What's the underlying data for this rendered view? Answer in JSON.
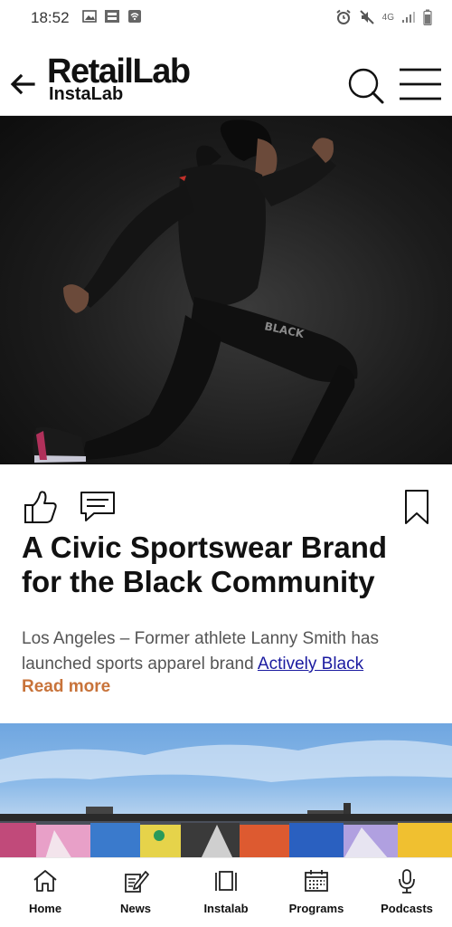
{
  "status_bar": {
    "time": "18:52",
    "network": "4G",
    "left_icons": [
      "image-icon",
      "stop-covid-icon",
      "wifi-calling-icon"
    ],
    "right_icons": [
      "alarm-icon",
      "mute-icon",
      "network-4g-icon",
      "signal-icon",
      "battery-icon"
    ]
  },
  "header": {
    "logo_main": "RetailLab",
    "logo_sub": "InstaLab",
    "icons": [
      "back-arrow-icon",
      "search-icon",
      "menu-icon"
    ]
  },
  "hero": {
    "garment_text": "BLACK"
  },
  "article": {
    "title": "A Civic Sportswear Brand for the Black Community",
    "excerpt_text": "Los Angeles – Former athlete Lanny Smith has launched sports apparel brand ",
    "excerpt_link": "Actively Black",
    "read_more": "Read more",
    "action_icons": [
      "thumbs-up-icon",
      "comment-icon",
      "bookmark-icon"
    ]
  },
  "bottom_nav": [
    {
      "label": "Home",
      "icon": "home-icon"
    },
    {
      "label": "News",
      "icon": "news-icon"
    },
    {
      "label": "Instalab",
      "icon": "instalab-icon"
    },
    {
      "label": "Programs",
      "icon": "programs-icon"
    },
    {
      "label": "Podcasts",
      "icon": "podcasts-icon"
    }
  ],
  "colors": {
    "accent": "#c8733a",
    "link": "#1a1aa0",
    "text": "#111111",
    "muted_text": "#555555"
  }
}
